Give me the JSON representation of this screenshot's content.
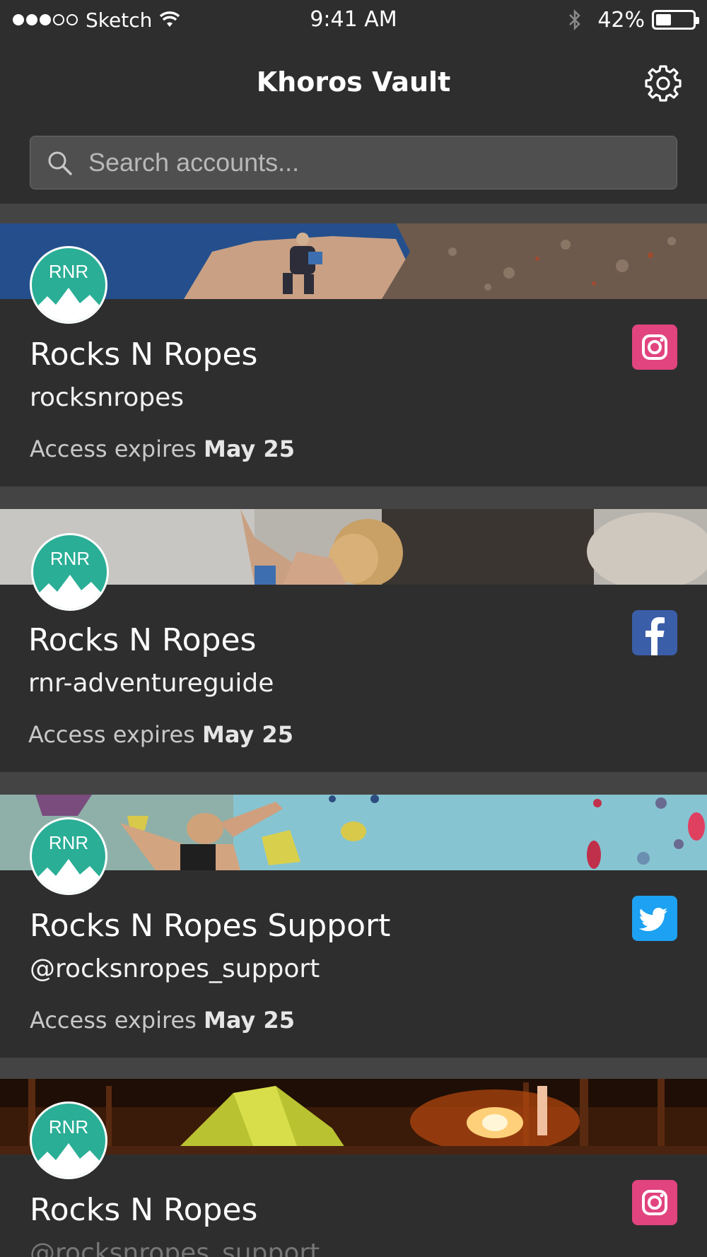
{
  "status_bar": {
    "carrier": "Sketch",
    "time": "9:41 AM",
    "battery_percent": "42%",
    "battery_level": 0.42,
    "signal_dots_filled": 3,
    "signal_dots_total": 5
  },
  "nav": {
    "title": "Khoros Vault",
    "settings_icon": "gear-icon"
  },
  "search": {
    "placeholder": "Search accounts..."
  },
  "colors": {
    "background": "#2e2e2e",
    "separator": "#444444",
    "avatar": "#2aae96",
    "instagram": "#e1447f",
    "facebook": "#3b5ea8",
    "twitter": "#1da1f2"
  },
  "accounts": [
    {
      "avatar_text": "RNR",
      "name": "Rocks N Ropes",
      "handle": "rocksnropes",
      "expires_prefix": "Access expires",
      "expires_date": "May 25",
      "network": "instagram-icon",
      "banner": "rock-climber-banner"
    },
    {
      "avatar_text": "RNR",
      "name": "Rocks N Ropes",
      "handle": "rnr-adventureguide",
      "expires_prefix": "Access expires",
      "expires_date": "May 25",
      "network": "facebook-icon",
      "banner": "climber-woman-banner"
    },
    {
      "avatar_text": "RNR",
      "name": "Rocks N Ropes Support",
      "handle": "@rocksnropes_support",
      "expires_prefix": "Access expires",
      "expires_date": "May 25",
      "network": "twitter-icon",
      "banner": "climbing-wall-banner"
    },
    {
      "avatar_text": "RNR",
      "name": "Rocks N Ropes",
      "handle": "@rocksnropes_support",
      "expires_prefix": "",
      "expires_date": "",
      "network": "instagram-icon",
      "banner": "campfire-tent-banner"
    }
  ]
}
